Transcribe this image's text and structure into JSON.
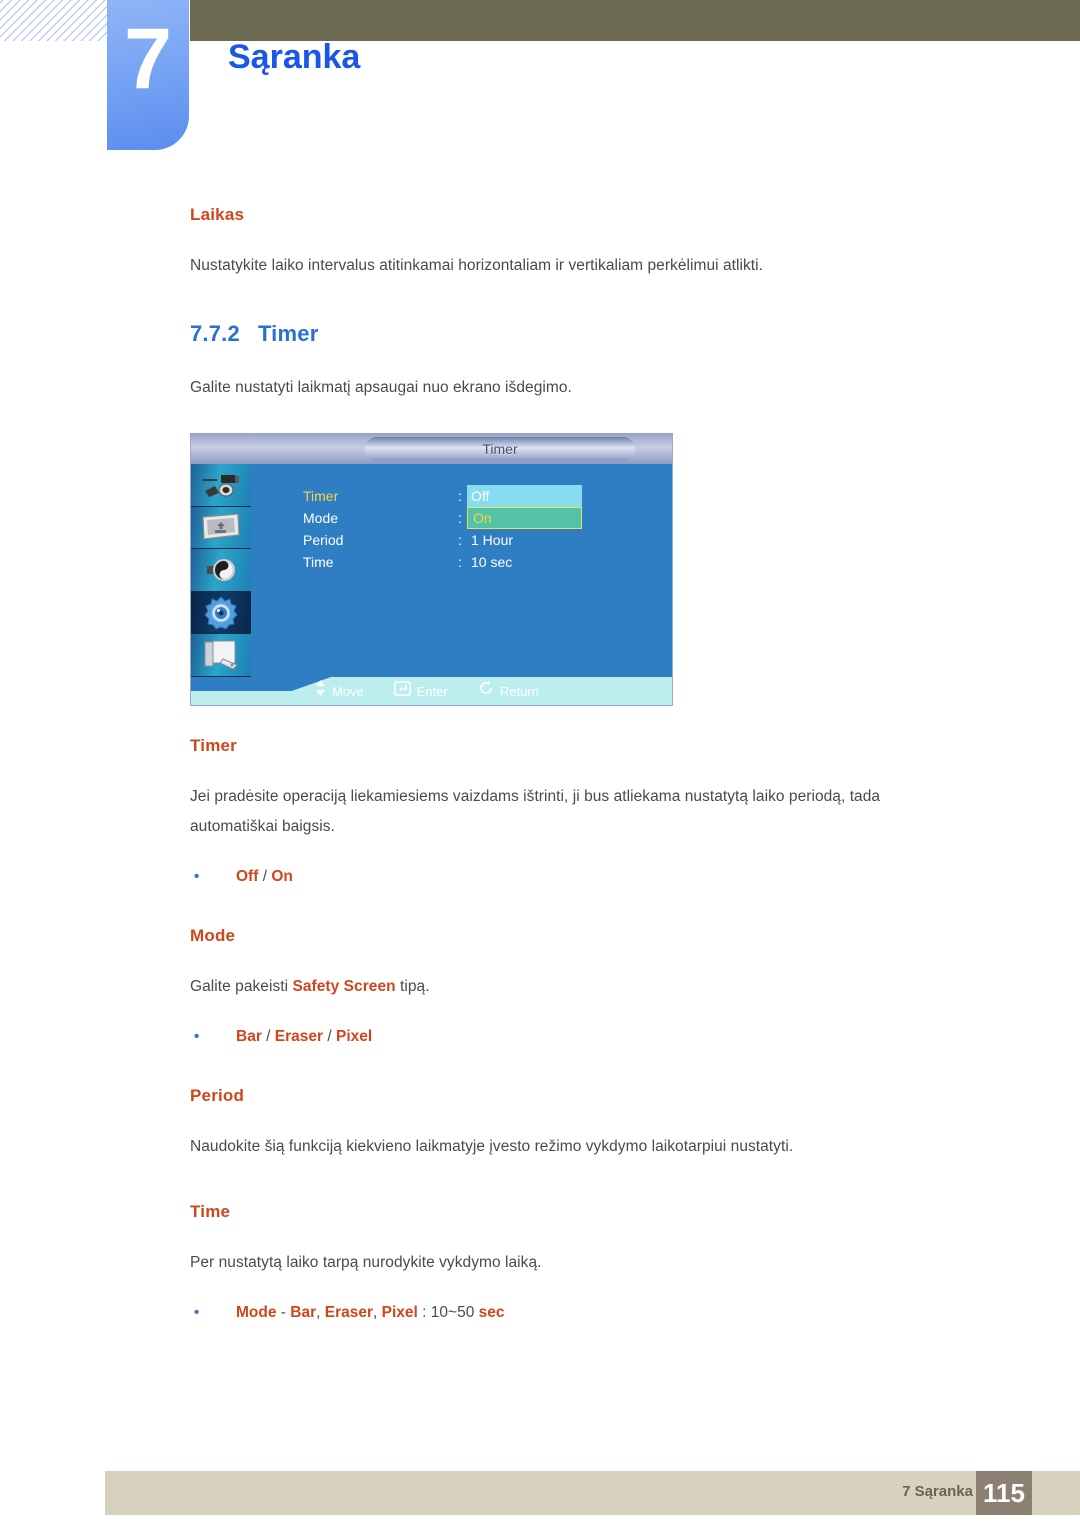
{
  "header": {
    "chapter_number": "7",
    "chapter_title": "Sąranka"
  },
  "content": {
    "laikas_heading": "Laikas",
    "laikas_body": "Nustatykite laiko intervalus atitinkamai horizontaliam ir vertikaliam perkėlimui atlikti.",
    "section_number": "7.7.2",
    "section_title": "Timer",
    "section_intro": "Galite nustatyti laikmatį apsaugai nuo ekrano išdegimo.",
    "timer_heading": "Timer",
    "timer_body": "Jei pradėsite operaciją liekamiesiems vaizdams ištrinti, ji bus atliekama nustatytą laiko periodą, tada automatiškai baigsis.",
    "timer_options": {
      "first": "Off",
      "sep": "/",
      "second": "On"
    },
    "mode_heading": "Mode",
    "mode_body_pre": "Galite pakeisti ",
    "mode_body_emph": "Safety Screen",
    "mode_body_post": " tipą.",
    "mode_options": {
      "first": "Bar",
      "sep1": "/",
      "second": "Eraser",
      "sep2": "/",
      "third": "Pixel"
    },
    "period_heading": "Period",
    "period_body": "Naudokite šią funkciją kiekvieno laikmatyje įvesto režimo vykdymo laikotarpiui nustatyti.",
    "time_heading": "Time",
    "time_body": "Per nustatytą laiko tarpą nurodykite vykdymo laiką.",
    "time_option": {
      "mode": "Mode",
      "dash": "-",
      "bar": "Bar",
      "comma1": ",",
      "eraser": "Eraser",
      "comma2": ",",
      "pixel": "Pixel",
      "colon": ":",
      "range": "10~50",
      "unit": "sec"
    },
    "bullet_glyph": "•"
  },
  "osd": {
    "title": "Timer",
    "rows": [
      {
        "label": "Timer",
        "colon": ":",
        "value": "Off",
        "highlight": "cyan",
        "active": true
      },
      {
        "label": "Mode",
        "colon": ":",
        "value": "On",
        "highlight": "green",
        "active": false
      },
      {
        "label": "Period",
        "colon": ":",
        "value": "1 Hour",
        "highlight": "none",
        "active": false
      },
      {
        "label": "Time",
        "colon": ":",
        "value": "10 sec",
        "highlight": "none",
        "active": false
      }
    ],
    "sidebar_icons": [
      {
        "name": "input-source-icon",
        "selected": false
      },
      {
        "name": "picture-display-icon",
        "selected": false
      },
      {
        "name": "sound-speaker-icon",
        "selected": false
      },
      {
        "name": "setup-gear-icon",
        "selected": true
      },
      {
        "name": "multi-control-panel-icon",
        "selected": false
      }
    ],
    "footer_items": [
      {
        "icon": "up-down-arrow-icon",
        "label": "Move"
      },
      {
        "icon": "enter-key-icon",
        "label": "Enter"
      },
      {
        "icon": "return-arrow-icon",
        "label": "Return"
      }
    ]
  },
  "footer": {
    "label": "7 Sąranka",
    "page_number": "115"
  },
  "colors": {
    "accent_orange": "#d0461b",
    "heading_blue": "#2a6fd6",
    "chapter_blue": "#1a56e8",
    "olive": "#6e6b53",
    "footer_band": "#d7d2bd",
    "page_box": "#8c8073",
    "osd_blue": "#2f7ec4",
    "osd_highlight_cyan": "#88dcf0",
    "osd_highlight_green": "#52c3a5",
    "osd_yellow": "#f5d544"
  }
}
